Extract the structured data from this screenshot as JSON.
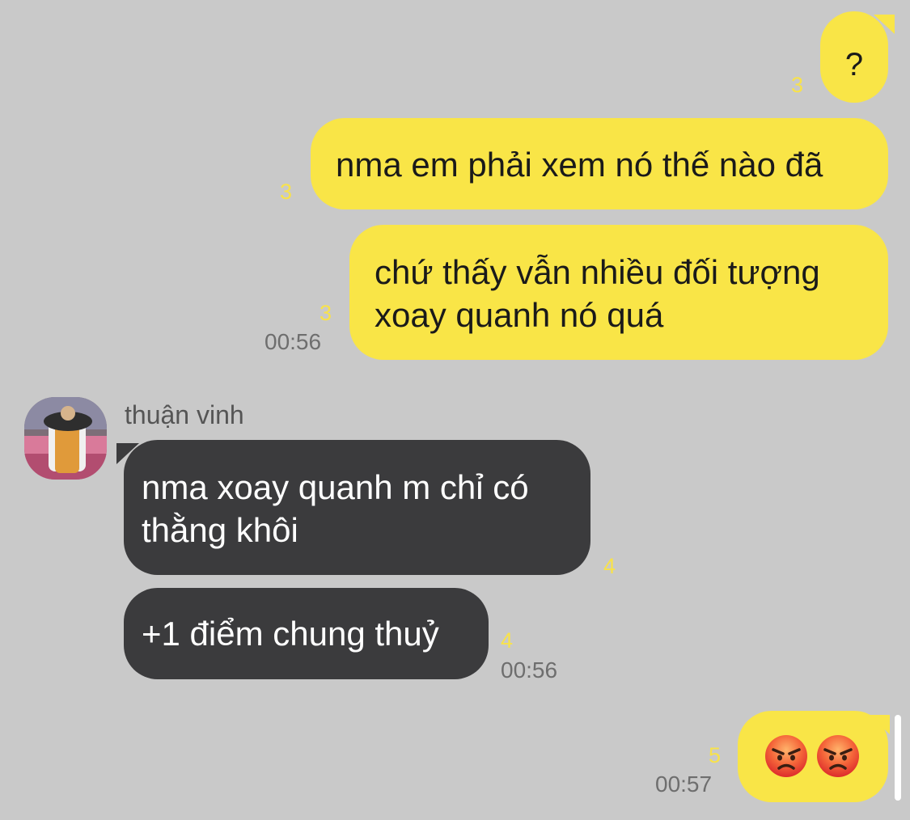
{
  "chat": {
    "messages": [
      {
        "id": "m1",
        "side": "outgoing",
        "text": "?",
        "unread": "3"
      },
      {
        "id": "m2",
        "side": "outgoing",
        "text": "nma em phải xem nó thế nào đã",
        "unread": "3"
      },
      {
        "id": "m3",
        "side": "outgoing",
        "lines": [
          "chứ thấy vẫn nhiều đối tượng",
          "xoay quanh nó quá"
        ],
        "unread": "3",
        "time": "00:56"
      },
      {
        "id": "m4",
        "side": "incoming",
        "sender": "thuận vinh",
        "lines": [
          "nma xoay quanh m chỉ có",
          "thằng khôi"
        ],
        "unread": "4"
      },
      {
        "id": "m5",
        "side": "incoming",
        "text": "+1 điểm chung thuỷ",
        "unread": "4",
        "time": "00:56"
      },
      {
        "id": "m6",
        "side": "outgoing",
        "emojis": [
          "angry-face",
          "angry-face"
        ],
        "unread": "5",
        "time": "00:57"
      }
    ]
  },
  "colors": {
    "background": "#c9c9c9",
    "outgoing_bubble": "#f9e547",
    "incoming_bubble": "#3b3b3d",
    "unread_count": "#f8e24a",
    "timestamp": "#6e6e6e"
  }
}
